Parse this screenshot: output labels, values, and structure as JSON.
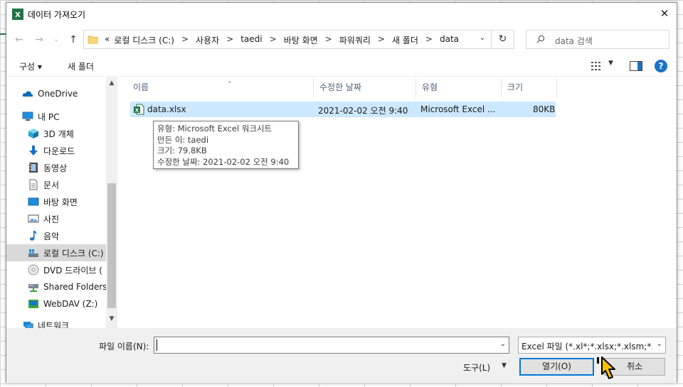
{
  "window": {
    "title": "데이터 가져오기"
  },
  "address": {
    "overflow_marker": "«",
    "crumbs": [
      "로컬 디스크 (C:)",
      "사용자",
      "taedi",
      "바탕 화면",
      "파워쿼리",
      "새 폴더",
      "data"
    ],
    "separator": ">"
  },
  "search": {
    "placeholder": "data 검색"
  },
  "toolbar": {
    "organize_label": "구성 ▾",
    "new_folder_label": "새 폴더",
    "help_label": "?"
  },
  "navpane": {
    "items": [
      {
        "label": "OneDrive",
        "icon": "cloud-icon"
      },
      {
        "label": "내 PC",
        "icon": "pc-icon"
      },
      {
        "label": "3D 개체",
        "icon": "cube-icon"
      },
      {
        "label": "다운로드",
        "icon": "download-icon"
      },
      {
        "label": "동영상",
        "icon": "video-icon"
      },
      {
        "label": "문서",
        "icon": "document-icon"
      },
      {
        "label": "바탕 화면",
        "icon": "desktop-icon"
      },
      {
        "label": "사진",
        "icon": "picture-icon"
      },
      {
        "label": "음악",
        "icon": "music-icon"
      },
      {
        "label": "로컬 디스크 (C:)",
        "icon": "drive-icon",
        "selected": true
      },
      {
        "label": "DVD 드라이브 (",
        "icon": "dvd-icon"
      },
      {
        "label": "Shared Folders(\\",
        "icon": "shared-drive-icon"
      },
      {
        "label": "WebDAV (Z:)",
        "icon": "webdav-drive-icon"
      },
      {
        "label": "네트워크",
        "icon": "network-icon"
      }
    ]
  },
  "filelist": {
    "columns": [
      "이름",
      "수정한 날짜",
      "유형",
      "크기"
    ],
    "rows": [
      {
        "name": "data.xlsx",
        "modified": "2021-02-02 오전 9:40",
        "type": "Microsoft Excel ...",
        "size": "80KB"
      }
    ]
  },
  "tooltip": {
    "lines": [
      "유형: Microsoft Excel 워크시트",
      "만든 이: taedi",
      "크기: 79.8KB",
      "수정한 날짜: 2021-02-02 오전 9:40"
    ]
  },
  "bottom": {
    "filename_label": "파일 이름(N):",
    "filename_value": "",
    "filter_value": "Excel 파일 (*.xl*;*.xlsx;*.xlsm;*.xlsb",
    "tools_label": "도구(L)",
    "open_label": "열기(O)",
    "cancel_label": "취소"
  },
  "colors": {
    "excel_green": "#217346",
    "selection_blue": "#cce8ff",
    "accent": "#0078d7"
  }
}
